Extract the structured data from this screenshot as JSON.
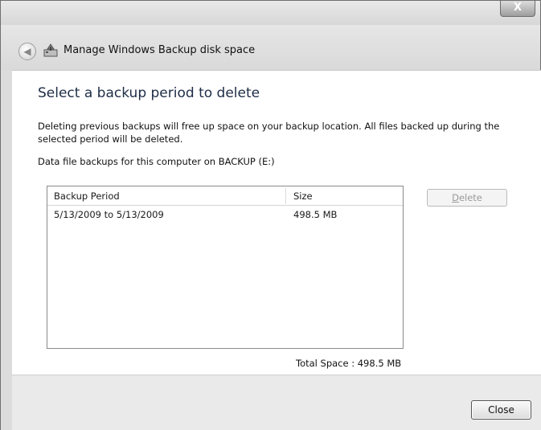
{
  "window": {
    "title": "Manage Windows Backup disk space",
    "close_glyph": "X"
  },
  "nav": {
    "back_icon": "back-arrow-icon",
    "app_icon": "backup-disk-icon"
  },
  "page": {
    "heading": "Select a backup period to delete",
    "description": "Deleting previous backups will free up space on your backup location. All files backed up during the selected period will be deleted.",
    "subdescription": "Data file backups for this computer on BACKUP (E:)"
  },
  "list": {
    "columns": [
      "Backup Period",
      "Size"
    ],
    "rows": [
      {
        "period": "5/13/2009 to 5/13/2009",
        "size": "498.5 MB"
      }
    ]
  },
  "buttons": {
    "delete_mnemonic": "D",
    "delete_rest": "elete",
    "close": "Close"
  },
  "total_space": "Total Space : 498.5 MB"
}
